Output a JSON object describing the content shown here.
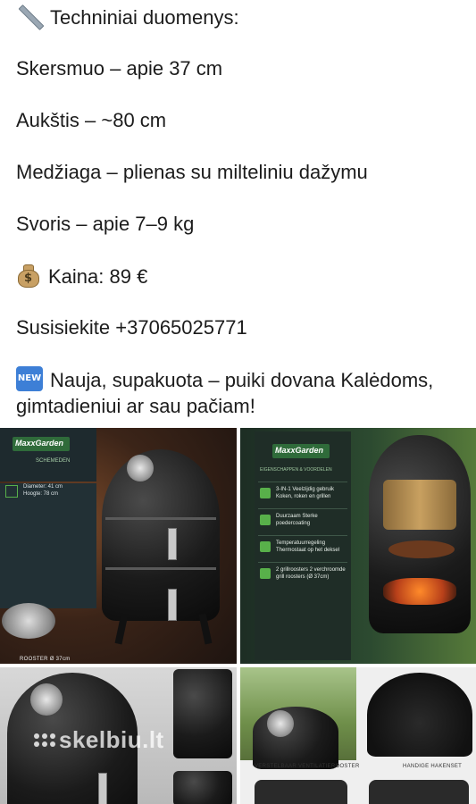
{
  "post": {
    "specs_heading": "Techniniai duomenys:",
    "lines": [
      "Skersmuo – apie 37 cm",
      "Aukštis – ~80 cm",
      "Medžiaga – plienas su milteliniu dažymu",
      "Svoris – apie 7–9 kg"
    ],
    "price": "Kaina: 89 €",
    "contact": "Susisiekite +37065025771",
    "new_text": "Nauja, supakuota – puiki dovana Kalėdoms, gimtadieniui ar sau pačiam!"
  },
  "icons": {
    "ruler": "straight-ruler-icon",
    "money_bag": "money-bag-icon",
    "new_button": "new-button-icon",
    "new_label": "NEW"
  },
  "photos": {
    "p1": {
      "brand": "MaxxGarden",
      "subtitle": "SCHEMEDEN",
      "spec1": "Diameter: 41 cm",
      "spec2": "Hoogte: 78 cm",
      "caption": "ROOSTER Ø 37cm"
    },
    "p2": {
      "brand": "MaxxGarden",
      "subtitle": "EIGENSCHAPPEN & VOORDELEN",
      "features": [
        "3-IN-1 Veelzijdig gebruik Koken, roken en grillen",
        "Duurzaam Sterke poedercoating",
        "Temperatuurregeling Thermostaat op het deksel",
        "2 grillroosters 2 verchroomde grill roosters (Ø 37cm)"
      ]
    },
    "p3": {
      "watermark": "skelbiu.lt"
    },
    "p4": {
      "caption_left": "VERSTELBAAR VENTILATIEROOSTER",
      "caption_right": "HANDIGE HAKENSET"
    }
  },
  "colors": {
    "text": "#1c1c1c",
    "background": "#ffffff",
    "new_badge": "#3d7fd6",
    "brand_green": "#2f6b3a"
  }
}
